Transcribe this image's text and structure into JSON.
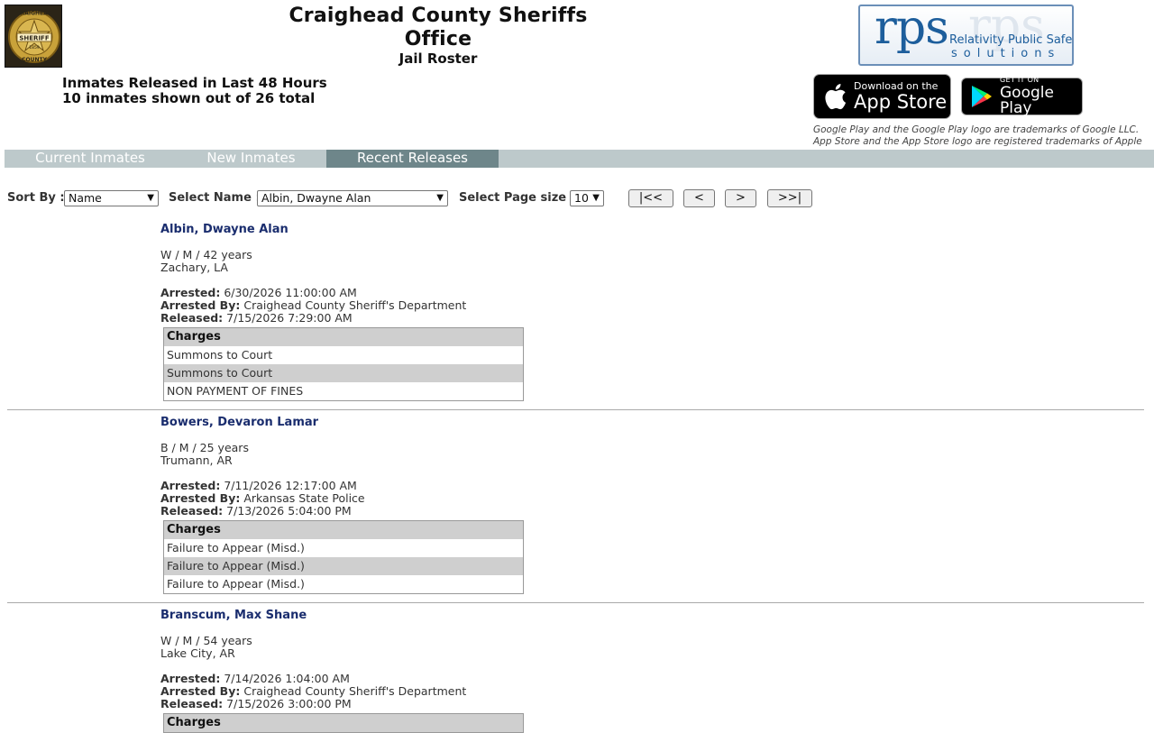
{
  "header": {
    "logo_text": [
      "CRAIGHEAD",
      "SHERIFF",
      "1859",
      "COUNTY"
    ],
    "title": "Craighead County Sheriffs Office",
    "subtitle": "Jail Roster",
    "rps_logo": {
      "mark": "rps",
      "line1": "Relativity Public Safety",
      "line2": "solutions"
    }
  },
  "summary": {
    "line1": "Inmates Released in Last 48 Hours",
    "line2": "10 inmates shown out of 26 total"
  },
  "stores": {
    "apple_small": "Download on the",
    "apple_big": "App Store",
    "google_small": "GET IT ON",
    "google_big": "Google Play",
    "trademark1": "Google Play and the Google Play logo are trademarks of Google LLC.",
    "trademark2": "App Store and the App Store logo are registered trademarks of Apple"
  },
  "tabs": [
    "Current Inmates",
    "New Inmates",
    "Recent Releases"
  ],
  "active_tab": "Recent Releases",
  "controls": {
    "sort_label": "Sort By :",
    "sort_value": "Name",
    "name_label": "Select Name :",
    "name_value": "Albin, Dwayne Alan",
    "pagesize_label": "Select Page size :",
    "pagesize_value": "10",
    "btn_first": "|<<",
    "btn_prev": "<",
    "btn_next": ">",
    "btn_last": ">>|"
  },
  "labels": {
    "arrested": "Arrested:",
    "arrested_by": "Arrested By:",
    "released": "Released:",
    "charges": "Charges"
  },
  "inmates": [
    {
      "name": "Albin, Dwayne Alan",
      "demographics": "W / M / 42 years",
      "location": "Zachary, LA",
      "arrested": "6/30/2026 11:00:00 AM",
      "arrested_by": "Craighead County Sheriff's Department",
      "released": "7/15/2026 7:29:00 AM",
      "charges": [
        "Summons to Court",
        "Summons to Court",
        "NON PAYMENT OF FINES"
      ]
    },
    {
      "name": "Bowers, Devaron Lamar",
      "demographics": "B / M / 25 years",
      "location": "Trumann, AR",
      "arrested": "7/11/2026 12:17:00 AM",
      "arrested_by": "Arkansas State Police",
      "released": "7/13/2026 5:04:00 PM",
      "charges": [
        "Failure to Appear (Misd.)",
        "Failure to Appear (Misd.)",
        "Failure to Appear (Misd.)"
      ]
    },
    {
      "name": "Branscum, Max Shane",
      "demographics": "W / M / 54 years",
      "location": "Lake City, AR",
      "arrested": "7/14/2026 1:04:00 AM",
      "arrested_by": "Craighead County Sheriff's Department",
      "released": "7/15/2026 3:00:00 PM",
      "charges": []
    }
  ]
}
